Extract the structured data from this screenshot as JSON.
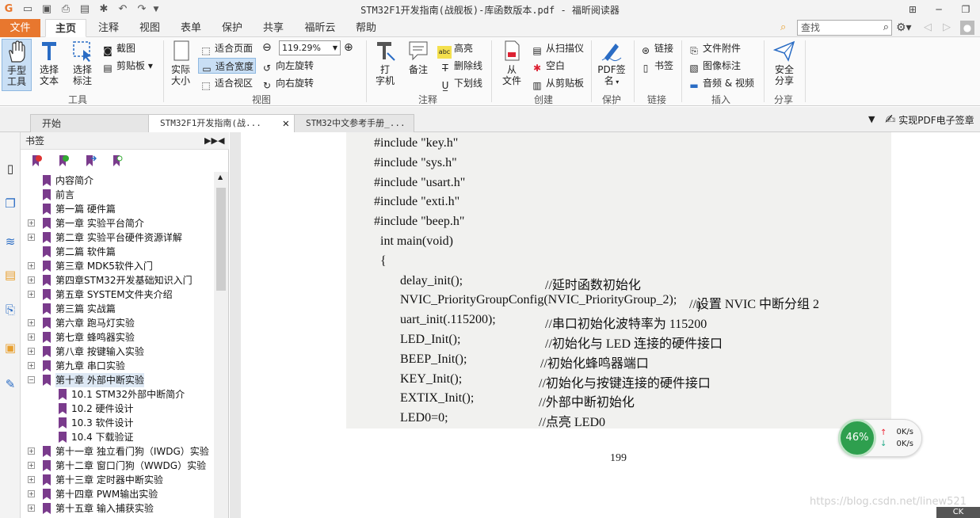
{
  "window": {
    "title": "STM32F1开发指南(战舰板)-库函数版本.pdf - 福昕阅读器"
  },
  "menu": {
    "file": "文件",
    "tabs": [
      "主页",
      "注释",
      "视图",
      "表单",
      "保护",
      "共享",
      "福昕云",
      "帮助"
    ],
    "active_tab": "主页",
    "search_placeholder": "查找"
  },
  "ribbon": {
    "tools": {
      "hand": "手型\n工具",
      "select_text": "选择\n文本",
      "select_annot": "选择\n标注",
      "screenshot": "截图",
      "clipboard": "剪贴板",
      "group": "工具"
    },
    "view": {
      "actual_size": "实际\n大小",
      "fit_page": "适合页面",
      "fit_width": "适合宽度",
      "fit_visible": "适合视区",
      "zoom": "119.29%",
      "rotate_left": "向左旋转",
      "rotate_right": "向右旋转",
      "group": "视图"
    },
    "comment": {
      "typewriter": "打\n字机",
      "note": "备注",
      "highlight": "高亮",
      "strikeout": "删除线",
      "underline": "下划线",
      "group": "注释"
    },
    "create": {
      "from_file": "从\n文件",
      "from_scanner": "从扫描仪",
      "blank": "空白",
      "from_clipboard": "从剪贴板",
      "group": "创建"
    },
    "protect": {
      "pdf_sign": "PDF签\n名",
      "group": "保护"
    },
    "links": {
      "link": "链接",
      "bookmark": "书签",
      "group": "链接"
    },
    "insert": {
      "attachment": "文件附件",
      "image_annot": "图像标注",
      "audio_video": "音频 & 视频",
      "group": "插入"
    },
    "share": {
      "secure_share": "安全\n分享",
      "group": "分享"
    }
  },
  "doc_tabs": [
    {
      "label": "开始"
    },
    {
      "label": "STM32F1开发指南(战..."
    },
    {
      "label": "STM32中文参考手册_..."
    }
  ],
  "sign_button": "实现PDF电子签章",
  "bookmarks": {
    "header": "书签",
    "items": [
      {
        "label": "内容简介",
        "level": 0,
        "expandable": false
      },
      {
        "label": "前言",
        "level": 0,
        "expandable": false
      },
      {
        "label": "第一篇 硬件篇",
        "level": 0,
        "expandable": false
      },
      {
        "label": "第一章 实验平台简介",
        "level": 0,
        "expandable": true
      },
      {
        "label": "第二章 实验平台硬件资源详解",
        "level": 0,
        "expandable": true
      },
      {
        "label": "第二篇 软件篇",
        "level": 0,
        "expandable": false
      },
      {
        "label": "第三章 MDK5软件入门",
        "level": 0,
        "expandable": true
      },
      {
        "label": "第四章STM32开发基础知识入门",
        "level": 0,
        "expandable": true
      },
      {
        "label": "第五章 SYSTEM文件夹介绍",
        "level": 0,
        "expandable": true
      },
      {
        "label": "第三篇 实战篇",
        "level": 0,
        "expandable": false
      },
      {
        "label": "第六章 跑马灯实验",
        "level": 0,
        "expandable": true
      },
      {
        "label": "第七章 蜂鸣器实验",
        "level": 0,
        "expandable": true
      },
      {
        "label": "第八章 按键输入实验",
        "level": 0,
        "expandable": true
      },
      {
        "label": "第九章 串口实验",
        "level": 0,
        "expandable": true
      },
      {
        "label": "第十章 外部中断实验",
        "level": 0,
        "expandable": true,
        "expanded": true,
        "selected": true
      },
      {
        "label": "10.1 STM32外部中断简介",
        "level": 1,
        "expandable": false
      },
      {
        "label": "10.2 硬件设计",
        "level": 1,
        "expandable": false
      },
      {
        "label": "10.3 软件设计",
        "level": 1,
        "expandable": false
      },
      {
        "label": "10.4 下载验证",
        "level": 1,
        "expandable": false
      },
      {
        "label": "第十一章 独立看门狗（IWDG）实验",
        "level": 0,
        "expandable": true
      },
      {
        "label": "第十二章 窗口门狗（WWDG）实验",
        "level": 0,
        "expandable": true
      },
      {
        "label": "第十三章 定时器中断实验",
        "level": 0,
        "expandable": true
      },
      {
        "label": "第十四章 PWM输出实验",
        "level": 0,
        "expandable": true
      },
      {
        "label": "第十五章 输入捕获实验",
        "level": 0,
        "expandable": true
      }
    ]
  },
  "document": {
    "code_lines": [
      {
        "code": "#include \"key.h\"",
        "comment": ""
      },
      {
        "code": "#include \"sys.h\"",
        "comment": ""
      },
      {
        "code": "#include \"usart.h\"",
        "comment": ""
      },
      {
        "code": "#include \"exti.h\"",
        "comment": ""
      },
      {
        "code": "#include \"beep.h\"",
        "comment": ""
      },
      {
        "code": "int main(void)",
        "comment": ""
      },
      {
        "code": "{",
        "comment": ""
      },
      {
        "code": "delay_init();",
        "comment": "//延时函数初始化"
      },
      {
        "code": "NVIC_PriorityGroupConfig(NVIC_PriorityGroup_2);",
        "comment": "//设置 NVIC 中断分组 2"
      },
      {
        "code": "uart_init(.115200);",
        "comment": "//串口初始化波特率为 115200"
      },
      {
        "code": "LED_Init();",
        "comment": "//初始化与 LED 连接的硬件接口"
      },
      {
        "code": "BEEP_Init();",
        "comment": "//初始化蜂鸣器端口"
      },
      {
        "code": "KEY_Init();",
        "comment": "//初始化与按键连接的硬件接口"
      },
      {
        "code": "EXTIX_Init();",
        "comment": "//外部中断初始化"
      },
      {
        "code": "LED0=0;",
        "comment": "//点亮 LED0"
      }
    ],
    "page_number": "199",
    "watermark": "https://blog.csdn.net/linew521"
  },
  "speed_widget": {
    "percent": "46%",
    "up": "0K/s",
    "down": "0K/s"
  },
  "ime": "CK",
  "colors": {
    "file_tab": "#e8772e",
    "bookmark_flag": "#7a3b8c",
    "speed_ring": "#2e9f4e"
  }
}
